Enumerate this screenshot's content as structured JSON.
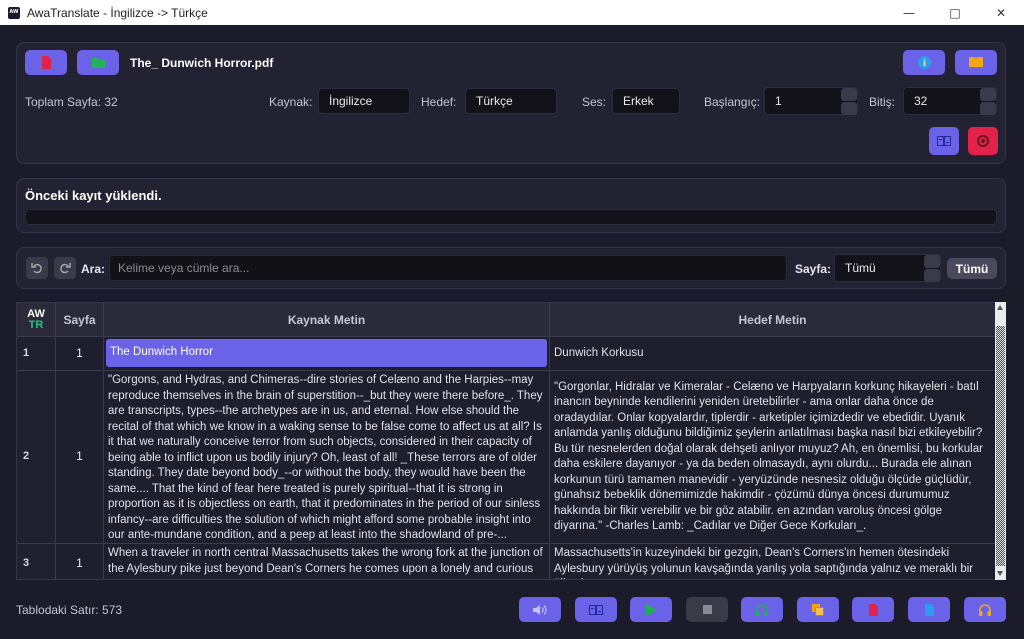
{
  "window": {
    "title": "AwaTranslate - İngilizce -> Türkçe",
    "icon_text": "AW"
  },
  "top_panel": {
    "filename": "The_ Dunwich Horror.pdf",
    "total_pages": "Toplam Sayfa: 32",
    "source_label": "Kaynak:",
    "source_value": "İngilizce",
    "target_label": "Hedef:",
    "target_value": "Türkçe",
    "voice_label": "Ses:",
    "voice_value": "Erkek",
    "start_label": "Başlangıç:",
    "start_value": "1",
    "end_label": "Bitiş:",
    "end_value": "32"
  },
  "status": {
    "message": "Önceki kayıt yüklendi.",
    "progress": 0
  },
  "search": {
    "label": "Ara:",
    "placeholder": "Kelime veya cümle ara...",
    "page_label": "Sayfa:",
    "page_value": "Tümü",
    "all_button": "Tümü"
  },
  "table": {
    "header_aw": "AW",
    "header_tr": "TR",
    "col_page": "Sayfa",
    "col_source": "Kaynak Metin",
    "col_target": "Hedef Metin",
    "rows": [
      {
        "num": "1",
        "page": "1",
        "source": "The Dunwich Horror",
        "target": "Dunwich Korkusu"
      },
      {
        "num": "2",
        "page": "1",
        "source": "\"Gorgons, and Hydras, and Chimeras--dire stories of Celæno and the Harpies--may reproduce themselves in the brain of superstition--_but they were there before_. They are transcripts, types--the archetypes are in us, and eternal. How else should the recital of that which we know in a waking sense to be false come to affect us at all? Is it that we naturally conceive terror from such objects, considered in their capacity of being able to inflict upon us bodily injury? Oh, least of all! _These terrors are of older standing. They date beyond body_--or without the body, they would have been the same.... That the kind of fear here treated is purely spiritual--that it is strong in proportion as it is objectless on earth, that it predominates in the period of our sinless infancy--are difficulties the solution of which might afford some probable insight into our ante-mundane condition, and a peep at least into the shadowland of pre-...",
        "target": "\"Gorgonlar, Hidralar ve Kimeralar - Celæno ve Harpyaların korkunç hikayeleri - batıl inancın beyninde kendilerini yeniden üretebilirler - ama onlar daha önce de oradaydılar. Onlar kopyalardır, tiplerdir - arketipler içimizdedir ve ebedidir. Uyanık anlamda yanlış olduğunu bildiğimiz şeylerin anlatılması başka nasıl bizi etkileyebilir? Bu tür nesnelerden doğal olarak dehşeti anlıyor muyuz? Ah, en önemlisi, bu korkular daha eskilere dayanıyor - ya da beden olmasaydı, aynı olurdu... Burada ele alınan korkunun türü tamamen manevidir - yeryüzünde nesnesiz olduğu ölçüde güçlüdür, günahsız bebeklik dönemimizde hakimdir - çözümü dünya öncesi durumumuz hakkında bir fikir verebilir ve bir göz atabilir. en azından varoluş öncesi gölge diyarına.\" -Charles Lamb: _Cadılar ve Diğer Gece Korkuları_."
      },
      {
        "num": "3",
        "page": "1",
        "source": "When a traveler in north central Massachusetts takes the wrong fork at the junction of the Aylesbury pike just beyond Dean's Corners he comes upon a lonely and curious ...",
        "target": "Massachusetts'in kuzeyindeki bir gezgin, Dean's Corners'ın hemen ötesindeki Aylesbury yürüyüş yolunun kavşağında yanlış yola saptığında yalnız ve meraklı bir ülkeyle ..."
      }
    ]
  },
  "footer": {
    "row_count": "Tablodaki Satır: 573"
  },
  "colors": {
    "accent": "#6a63e8",
    "danger": "#e1234b",
    "bg": "#1b1b29",
    "panel": "#232233"
  },
  "icons": [
    "pdf-icon",
    "folder-icon",
    "info-icon",
    "book-icon",
    "translate-icon",
    "record-icon",
    "undo-icon",
    "redo-icon",
    "volume-icon",
    "play-icon",
    "stop-icon",
    "copy-icon",
    "save-icon",
    "headphones-icon"
  ]
}
